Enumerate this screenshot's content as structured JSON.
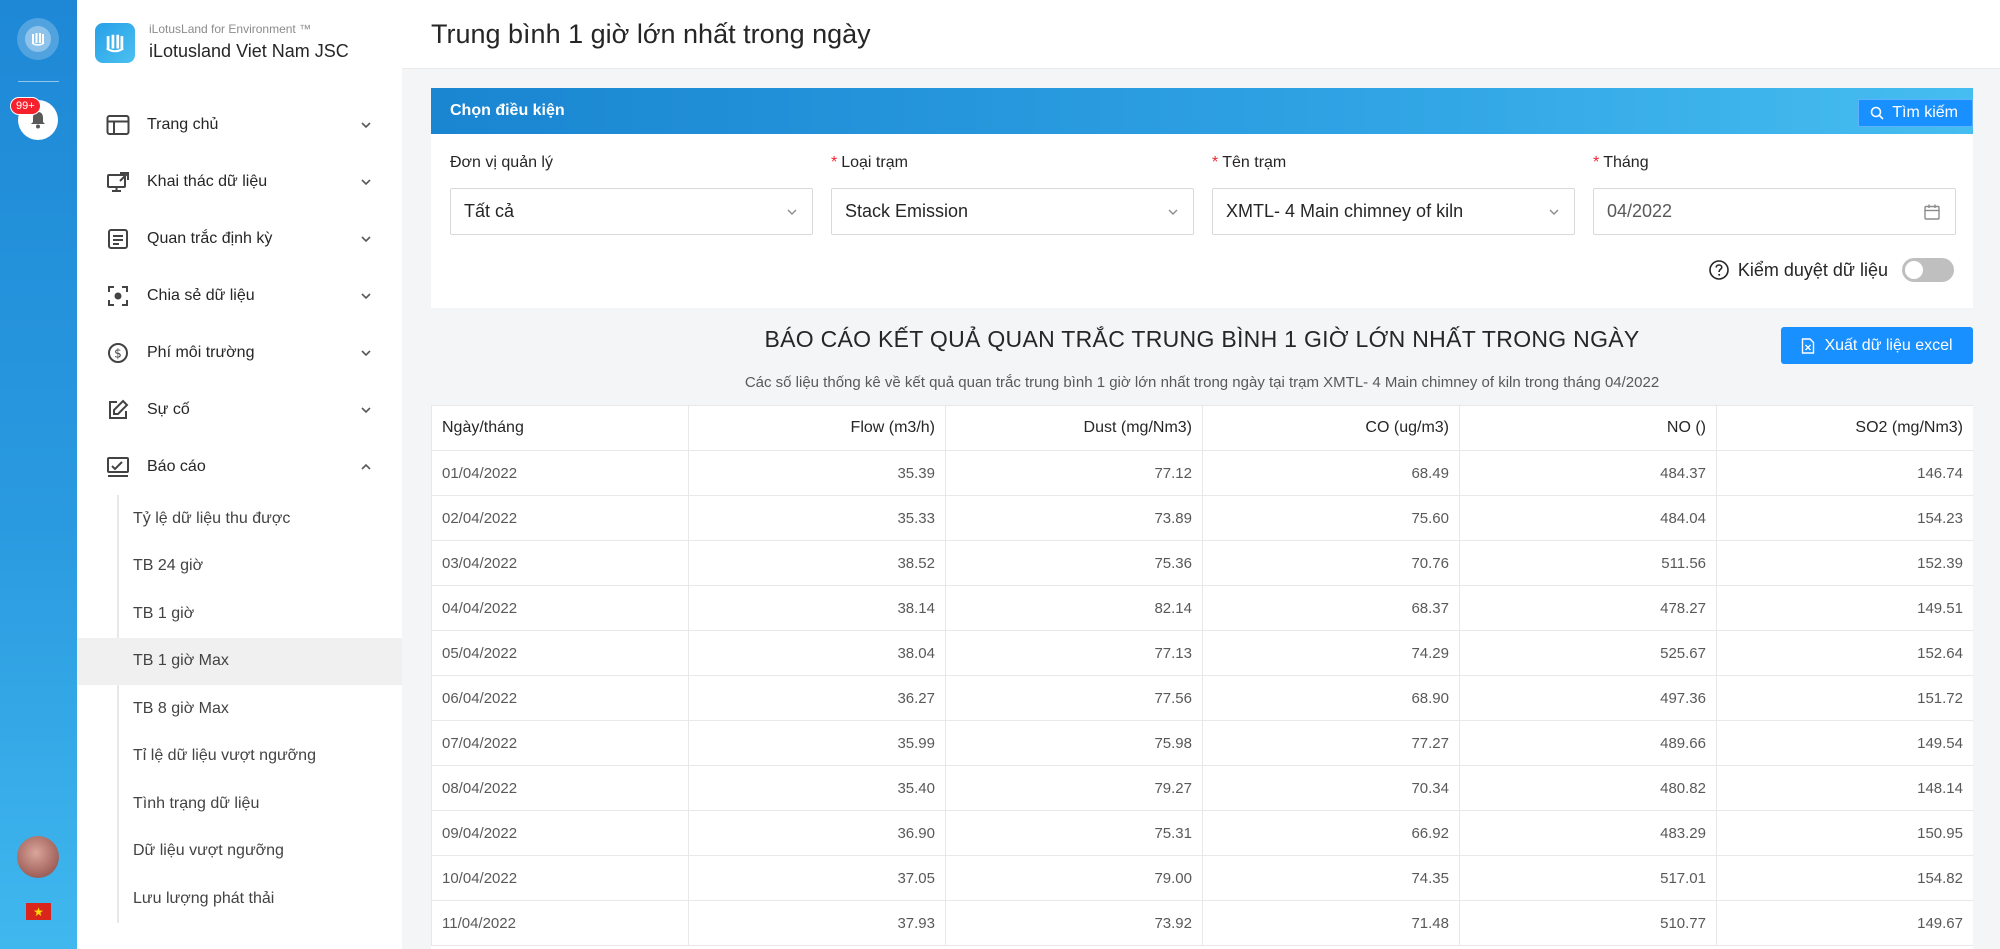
{
  "rail": {
    "badge": "99+"
  },
  "brand": {
    "subtitle": "iLotusLand for Environment ™",
    "name": "iLotusland Viet Nam JSC"
  },
  "menu": [
    {
      "label": "Trang chủ",
      "icon": "layout-icon"
    },
    {
      "label": "Khai thác dữ liệu",
      "icon": "monitor-share-icon"
    },
    {
      "label": "Quan trắc định kỳ",
      "icon": "document-list-icon"
    },
    {
      "label": "Chia sẻ dữ liệu",
      "icon": "scan-icon"
    },
    {
      "label": "Phí môi trường",
      "icon": "dollar-circle-icon"
    },
    {
      "label": "Sự cố",
      "icon": "edit-icon"
    },
    {
      "label": "Báo cáo",
      "icon": "report-icon"
    }
  ],
  "submenu": [
    {
      "label": "Tỷ lệ dữ liệu thu được"
    },
    {
      "label": "TB 24 giờ"
    },
    {
      "label": "TB 1 giờ"
    },
    {
      "label": "TB 1 giờ Max",
      "active": true
    },
    {
      "label": "TB 8 giờ Max"
    },
    {
      "label": "Tỉ lệ dữ liệu vượt ngưỡng"
    },
    {
      "label": "Tình trạng dữ liệu"
    },
    {
      "label": "Dữ liệu vượt ngưỡng"
    },
    {
      "label": "Lưu lượng phát thải"
    }
  ],
  "page": {
    "title": "Trung bình 1 giờ lớn nhất trong ngày"
  },
  "filter": {
    "title": "Chọn điều kiện",
    "search_label": "Tìm kiếm",
    "fields": {
      "unit": {
        "label": "Đơn vị quản lý",
        "value": "Tất cả"
      },
      "station_type": {
        "label": "Loại trạm",
        "value": "Stack Emission"
      },
      "station_name": {
        "label": "Tên trạm",
        "value": "XMTL- 4 Main chimney of kiln"
      },
      "month": {
        "label": "Tháng",
        "value": "04/2022"
      }
    },
    "approve_label": "Kiểm duyệt dữ liệu",
    "approve_on": false
  },
  "report": {
    "title": "BÁO CÁO KẾT QUẢ QUAN TRẮC TRUNG BÌNH 1 GIỜ LỚN NHẤT TRONG NGÀY",
    "subtitle": "Các số liệu thống kê về kết quả quan trắc trung bình 1 giờ lớn nhất trong ngày tại trạm XMTL- 4 Main chimney of kiln trong tháng 04/2022",
    "export_label": "Xuất dữ liệu excel"
  },
  "table": {
    "columns": [
      "Ngày/tháng",
      "Flow (m3/h)",
      "Dust (mg/Nm3)",
      "CO (ug/m3)",
      "NO ()",
      "SO2 (mg/Nm3)"
    ],
    "rows": [
      [
        "01/04/2022",
        "35.39",
        "77.12",
        "68.49",
        "484.37",
        "146.74"
      ],
      [
        "02/04/2022",
        "35.33",
        "73.89",
        "75.60",
        "484.04",
        "154.23"
      ],
      [
        "03/04/2022",
        "38.52",
        "75.36",
        "70.76",
        "511.56",
        "152.39"
      ],
      [
        "04/04/2022",
        "38.14",
        "82.14",
        "68.37",
        "478.27",
        "149.51"
      ],
      [
        "05/04/2022",
        "38.04",
        "77.13",
        "74.29",
        "525.67",
        "152.64"
      ],
      [
        "06/04/2022",
        "36.27",
        "77.56",
        "68.90",
        "497.36",
        "151.72"
      ],
      [
        "07/04/2022",
        "35.99",
        "75.98",
        "77.27",
        "489.66",
        "149.54"
      ],
      [
        "08/04/2022",
        "35.40",
        "79.27",
        "70.34",
        "480.82",
        "148.14"
      ],
      [
        "09/04/2022",
        "36.90",
        "75.31",
        "66.92",
        "483.29",
        "150.95"
      ],
      [
        "10/04/2022",
        "37.05",
        "79.00",
        "74.35",
        "517.01",
        "154.82"
      ],
      [
        "11/04/2022",
        "37.93",
        "73.92",
        "71.48",
        "510.77",
        "149.67"
      ]
    ]
  }
}
